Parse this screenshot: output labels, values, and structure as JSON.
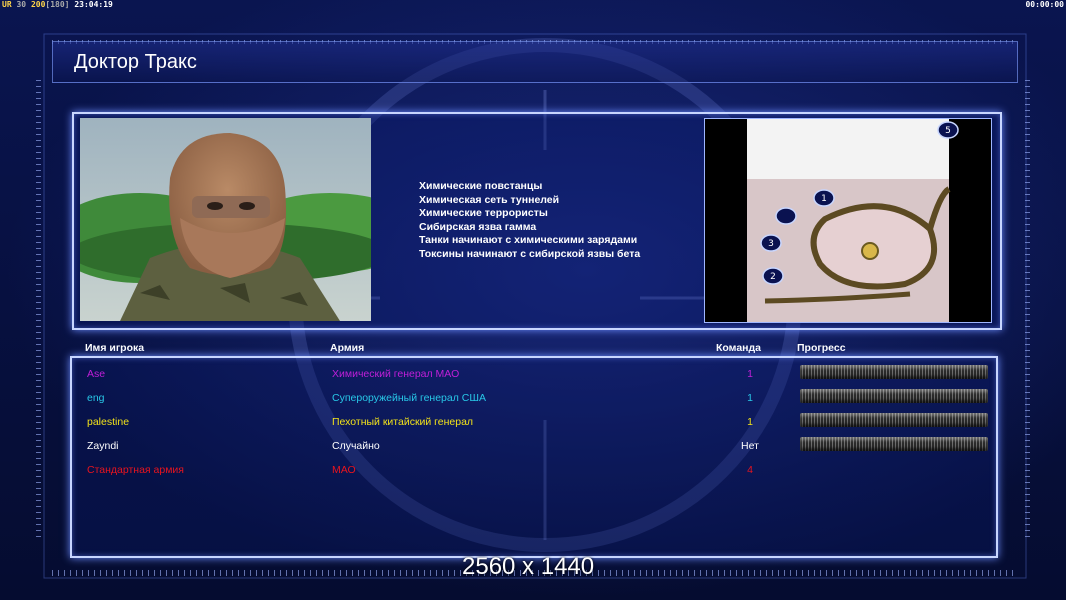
{
  "hud": {
    "left_prefix": "UR",
    "left_a": "30",
    "left_b": "200",
    "left_c": "[180]",
    "left_time": "23:04:19",
    "right_time": "00:00:00"
  },
  "briefing": {
    "general_name": "Доктор Тракс",
    "features": [
      "Химические повстанцы",
      "Химическая сеть туннелей",
      "Химические террористы",
      "Сибирская язва гамма",
      "Танки начинают с химическими зарядами",
      "Токсины начинают с сибирской язвы бета"
    ]
  },
  "minimap": {
    "markers": [
      "1",
      "2",
      "3",
      "5"
    ]
  },
  "table": {
    "headers": {
      "name": "Имя игрока",
      "army": "Армия",
      "team": "Команда",
      "progress": "Прогресс"
    },
    "rows": [
      {
        "name": "Ase",
        "army": "Химический генерал МАО",
        "team": "1",
        "color": "#c01fd8",
        "has_progress": true
      },
      {
        "name": "eng",
        "army": "Супероружейный генерал США",
        "team": "1",
        "color": "#28c8e8",
        "has_progress": true
      },
      {
        "name": "palestine",
        "army": "Пехотный китайский генерал",
        "team": "1",
        "color": "#f2e21a",
        "has_progress": true
      },
      {
        "name": "Zayndi",
        "army": "Случайно",
        "team": "Нет",
        "color": "#ffffff",
        "has_progress": true
      },
      {
        "name": "Стандартная армия",
        "army": "МАО",
        "team": "4",
        "color": "#e8141e",
        "has_progress": false
      }
    ]
  },
  "resolution_label": "2560 x 1440"
}
